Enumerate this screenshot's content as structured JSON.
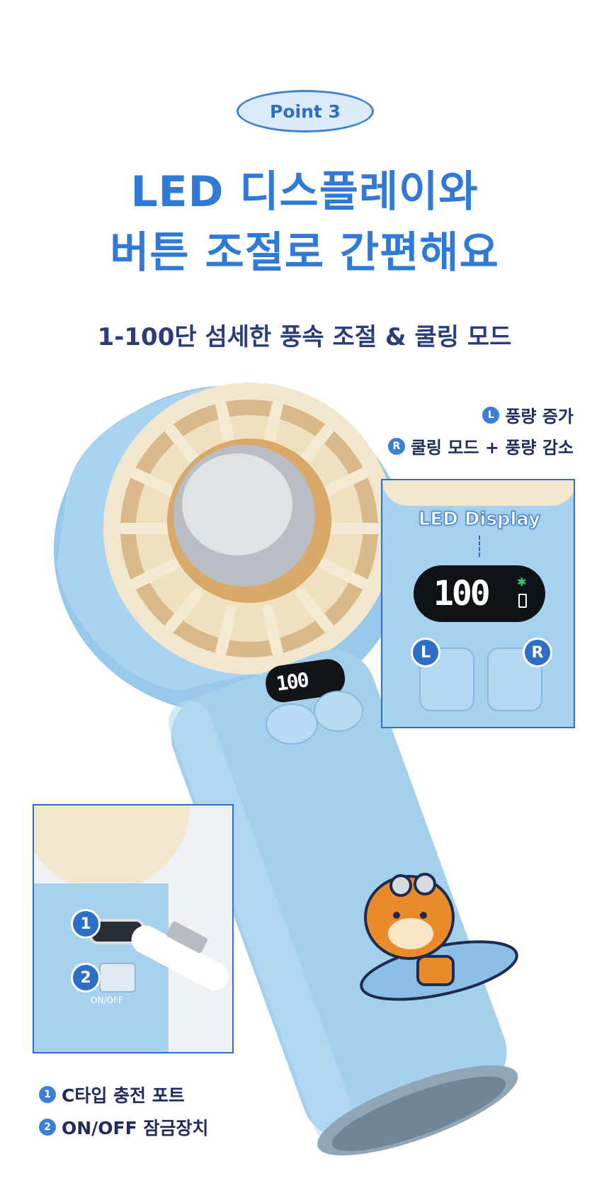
{
  "header": {
    "point_label": "Point 3",
    "title_line1": "LED 디스플레이와",
    "title_line2": "버튼 조절로 간편해요",
    "subtitle": "1-100단 섬세한 풍속 조절 & 쿨링 모드"
  },
  "button_legend": [
    {
      "key": "L",
      "text": "풍량 증가"
    },
    {
      "key": "R",
      "text": "쿨링 모드 + 풍량 감소"
    }
  ],
  "display_inset": {
    "label": "LED Display",
    "screen_value": "100",
    "left_button": "L",
    "right_button": "R"
  },
  "product": {
    "screen_value": "100"
  },
  "port_inset": {
    "marker1": "1",
    "marker2": "2",
    "switch_label": "ON/OFF"
  },
  "port_legend": [
    {
      "key": "1",
      "text": "C타입 충전 포트"
    },
    {
      "key": "2",
      "text": "ON/OFF 잠금장치"
    }
  ],
  "colors": {
    "accent": "#2f7ad9",
    "fan_body": "#a7d2ef",
    "fan_ring": "#f3e6c9",
    "navy_text": "#1f2b5c"
  }
}
